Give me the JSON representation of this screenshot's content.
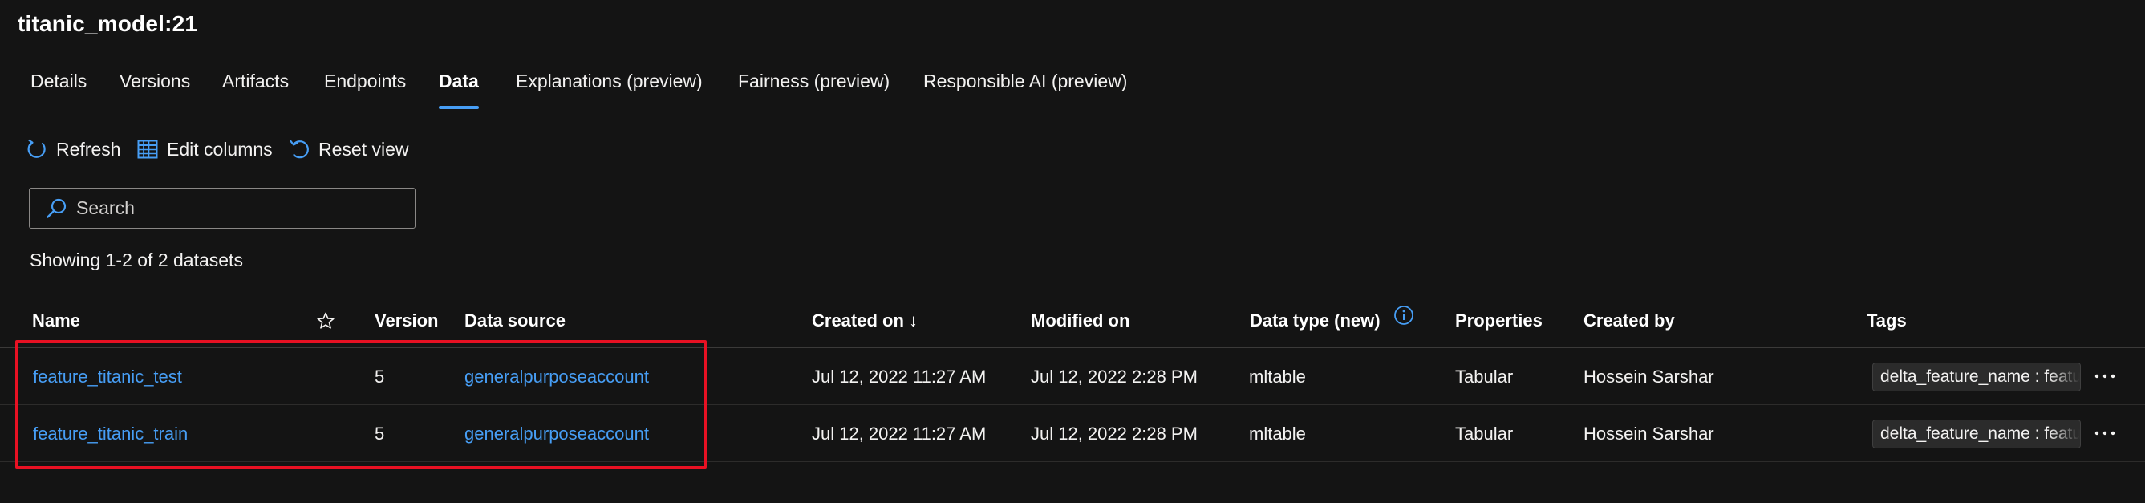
{
  "page": {
    "title": "titanic_model:21"
  },
  "tabs": [
    {
      "label": "Details"
    },
    {
      "label": "Versions"
    },
    {
      "label": "Artifacts"
    },
    {
      "label": "Endpoints"
    },
    {
      "label": "Data",
      "active": true
    },
    {
      "label": "Explanations (preview)"
    },
    {
      "label": "Fairness (preview)"
    },
    {
      "label": "Responsible AI (preview)"
    }
  ],
  "toolbar": {
    "refresh_label": "Refresh",
    "edit_columns_label": "Edit columns",
    "reset_view_label": "Reset view"
  },
  "search": {
    "placeholder": "Search",
    "value": ""
  },
  "summary": {
    "showing_text": "Showing 1-2 of 2 datasets"
  },
  "table": {
    "columns": {
      "name": "Name",
      "version": "Version",
      "data_source": "Data source",
      "created_on": "Created on ↓",
      "modified_on": "Modified on",
      "data_type": "Data type (new)",
      "properties": "Properties",
      "created_by": "Created by",
      "tags": "Tags"
    },
    "rows": [
      {
        "name": "feature_titanic_test",
        "version": "5",
        "data_source": "generalpurposeaccount",
        "created_on": "Jul 12, 2022 11:27 AM",
        "modified_on": "Jul 12, 2022 2:28 PM",
        "data_type": "mltable",
        "properties": "Tabular",
        "created_by": "Hossein Sarshar",
        "tag": "delta_feature_name : feature_titanic"
      },
      {
        "name": "feature_titanic_train",
        "version": "5",
        "data_source": "generalpurposeaccount",
        "created_on": "Jul 12, 2022 11:27 AM",
        "modified_on": "Jul 12, 2022 2:28 PM",
        "data_type": "mltable",
        "properties": "Tabular",
        "created_by": "Hossein Sarshar",
        "tag": "delta_feature_name : feature_titanic"
      }
    ]
  },
  "colors": {
    "background": "#141414",
    "accent": "#479ef5",
    "highlight": "#e81123"
  }
}
